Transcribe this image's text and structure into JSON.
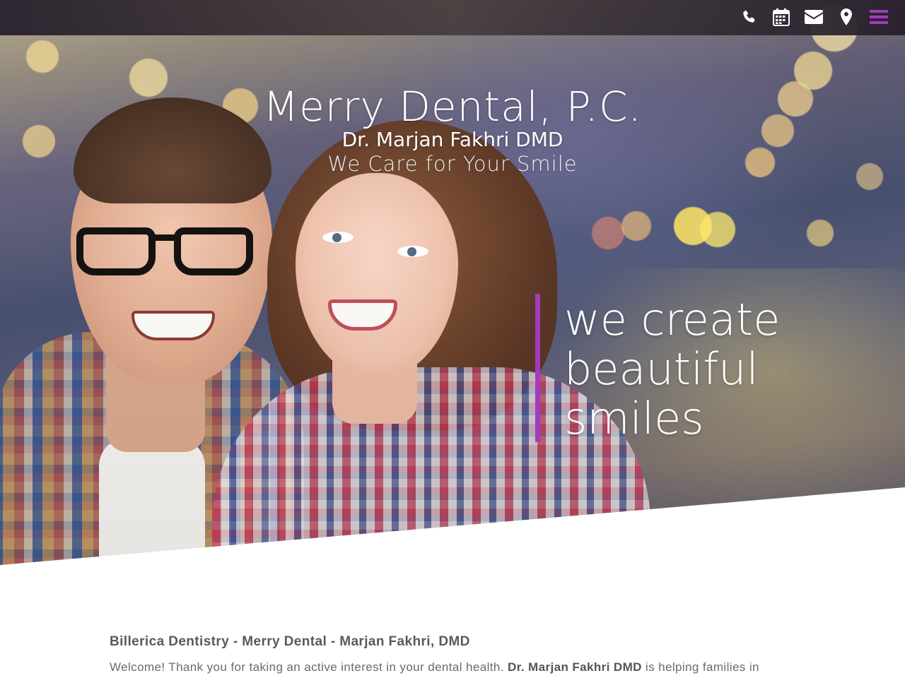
{
  "top_bar": {
    "icons": [
      {
        "name": "phone-icon"
      },
      {
        "name": "calendar-icon"
      },
      {
        "name": "envelope-icon"
      },
      {
        "name": "map-marker-icon"
      },
      {
        "name": "menu-icon",
        "color": "#a23bbd"
      }
    ]
  },
  "hero": {
    "practice_name": "Merry Dental, P.C.",
    "doctor": "Dr. Marjan Fakhri DMD",
    "tagline": "We Care for Your Smile",
    "slogan_lines": [
      "we create",
      "beautiful",
      "smiles"
    ],
    "accent_color": "#a23bbd"
  },
  "content": {
    "title": "Billerica Dentistry - Merry Dental - Marjan Fakhri, DMD",
    "intro_before": "Welcome! Thank you for taking an active interest in your dental health. ",
    "intro_bold": "Dr. Marjan Fakhri DMD",
    "intro_after": " is helping families in"
  }
}
